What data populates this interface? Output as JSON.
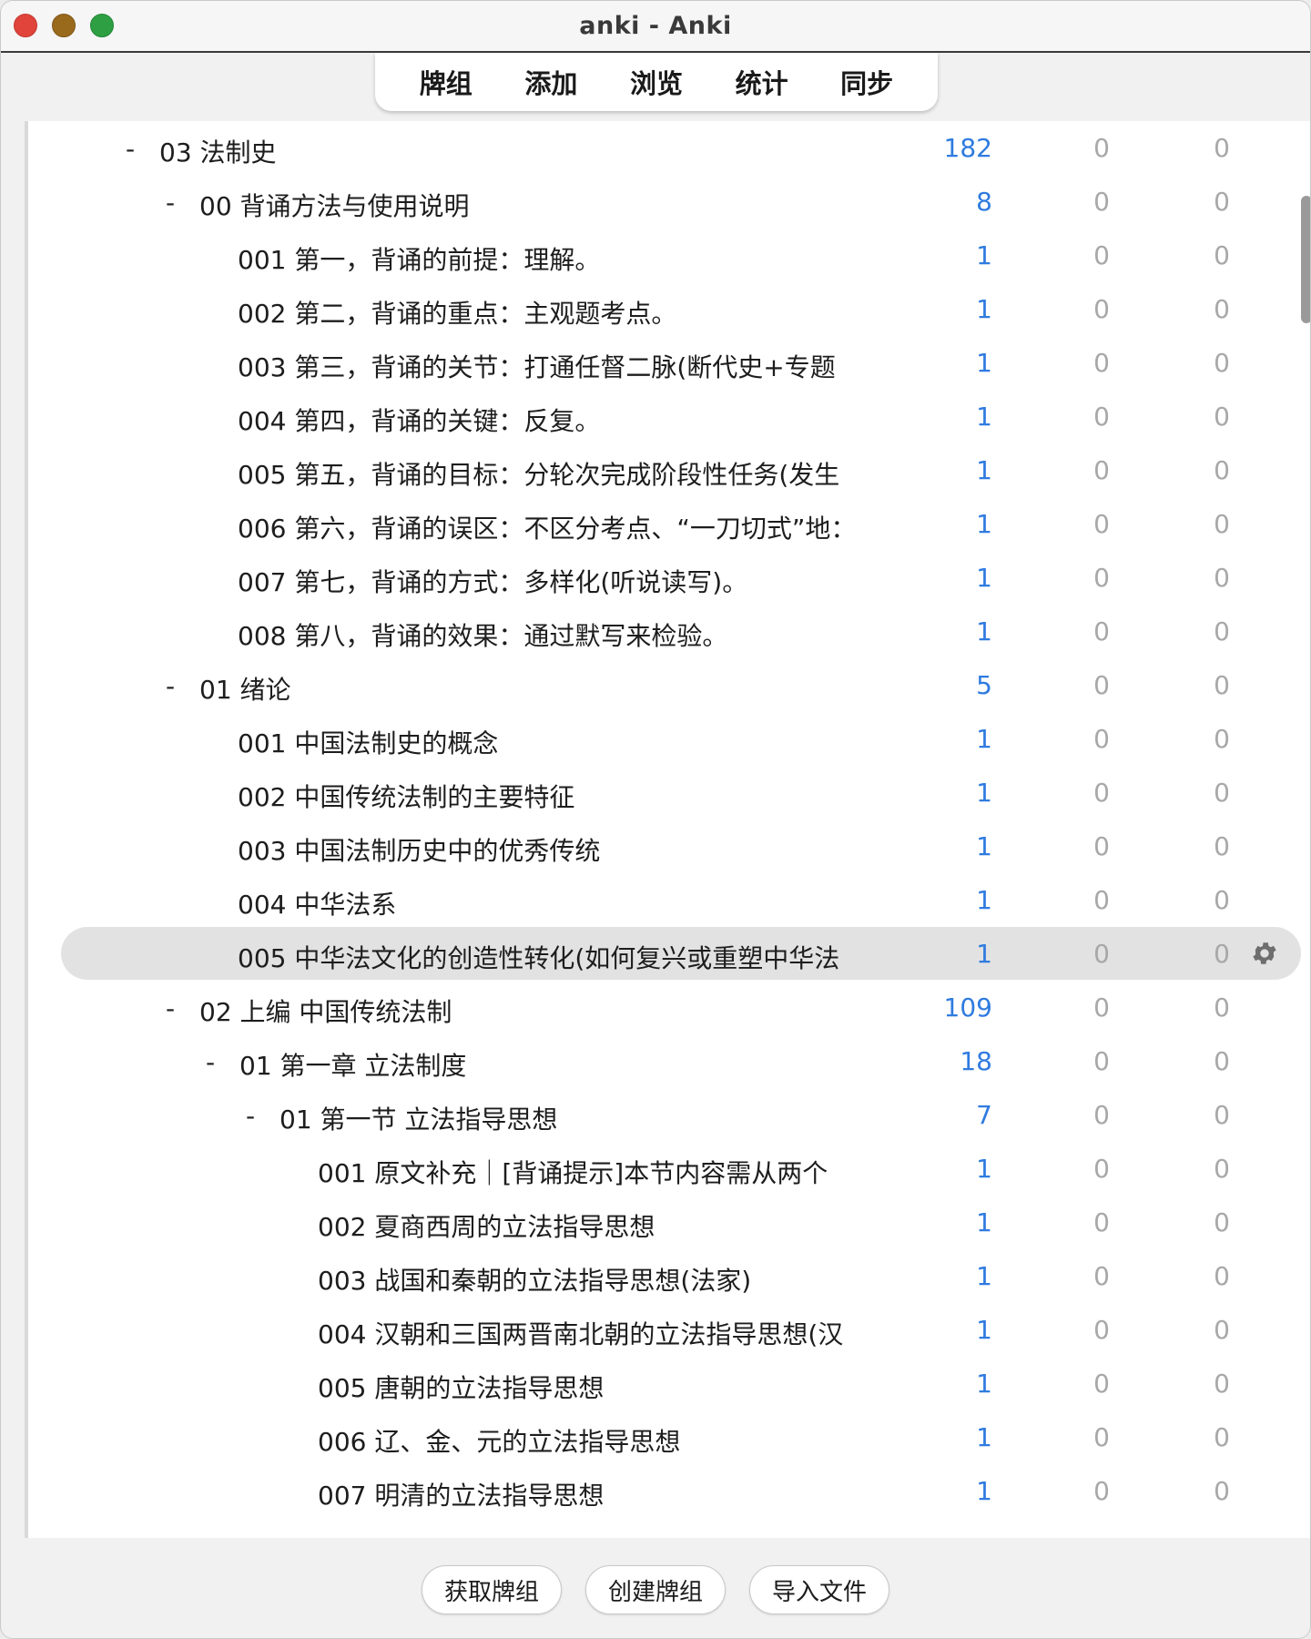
{
  "window": {
    "title": "anki - Anki"
  },
  "toolbar": {
    "items": [
      "牌组",
      "添加",
      "浏览",
      "统计",
      "同步"
    ]
  },
  "decks": [
    {
      "name": "03 法制史",
      "new": "182",
      "learn": "0",
      "due": "0",
      "level": 0,
      "collapse": "-"
    },
    {
      "name": "00 背诵方法与使用说明",
      "new": "8",
      "learn": "0",
      "due": "0",
      "level": 1,
      "collapse": "-"
    },
    {
      "name": "001 第一，背诵的前提：理解。",
      "new": "1",
      "learn": "0",
      "due": "0",
      "level": 2,
      "collapse": ""
    },
    {
      "name": "002 第二，背诵的重点：主观题考点。",
      "new": "1",
      "learn": "0",
      "due": "0",
      "level": 2,
      "collapse": ""
    },
    {
      "name": "003 第三，背诵的关节：打通任督二脉(断代史+专题",
      "new": "1",
      "learn": "0",
      "due": "0",
      "level": 2,
      "collapse": ""
    },
    {
      "name": "004 第四，背诵的关键：反复。",
      "new": "1",
      "learn": "0",
      "due": "0",
      "level": 2,
      "collapse": ""
    },
    {
      "name": "005 第五，背诵的目标：分轮次完成阶段性任务(发生",
      "new": "1",
      "learn": "0",
      "due": "0",
      "level": 2,
      "collapse": ""
    },
    {
      "name": "006 第六，背诵的误区：不区分考点、“一刀切式”地：",
      "new": "1",
      "learn": "0",
      "due": "0",
      "level": 2,
      "collapse": ""
    },
    {
      "name": "007 第七，背诵的方式：多样化(听说读写)。",
      "new": "1",
      "learn": "0",
      "due": "0",
      "level": 2,
      "collapse": ""
    },
    {
      "name": "008 第八，背诵的效果：通过默写来检验。",
      "new": "1",
      "learn": "0",
      "due": "0",
      "level": 2,
      "collapse": ""
    },
    {
      "name": "01 绪论",
      "new": "5",
      "learn": "0",
      "due": "0",
      "level": 1,
      "collapse": "-"
    },
    {
      "name": "001 中国法制史的概念",
      "new": "1",
      "learn": "0",
      "due": "0",
      "level": 2,
      "collapse": ""
    },
    {
      "name": "002 中国传统法制的主要特征",
      "new": "1",
      "learn": "0",
      "due": "0",
      "level": 2,
      "collapse": ""
    },
    {
      "name": "003 中国法制历史中的优秀传统",
      "new": "1",
      "learn": "0",
      "due": "0",
      "level": 2,
      "collapse": ""
    },
    {
      "name": "004 中华法系",
      "new": "1",
      "learn": "0",
      "due": "0",
      "level": 2,
      "collapse": ""
    },
    {
      "name": "005 中华法文化的创造性转化(如何复兴或重塑中华法",
      "new": "1",
      "learn": "0",
      "due": "0",
      "level": 2,
      "collapse": "",
      "selected": true
    },
    {
      "name": "02 上编 中国传统法制",
      "new": "109",
      "learn": "0",
      "due": "0",
      "level": 1,
      "collapse": "-"
    },
    {
      "name": "01 第一章 立法制度",
      "new": "18",
      "learn": "0",
      "due": "0",
      "level": 2,
      "collapse": "-"
    },
    {
      "name": "01 第一节 立法指导思想",
      "new": "7",
      "learn": "0",
      "due": "0",
      "level": 3,
      "collapse": "-"
    },
    {
      "name": "001 原文补充｜[背诵提示]本节内容需从两个",
      "new": "1",
      "learn": "0",
      "due": "0",
      "level": 4,
      "collapse": ""
    },
    {
      "name": "002 夏商西周的立法指导思想",
      "new": "1",
      "learn": "0",
      "due": "0",
      "level": 4,
      "collapse": ""
    },
    {
      "name": "003 战国和秦朝的立法指导思想(法家)",
      "new": "1",
      "learn": "0",
      "due": "0",
      "level": 4,
      "collapse": ""
    },
    {
      "name": "004 汉朝和三国两晋南北朝的立法指导思想(汉",
      "new": "1",
      "learn": "0",
      "due": "0",
      "level": 4,
      "collapse": ""
    },
    {
      "name": "005 唐朝的立法指导思想",
      "new": "1",
      "learn": "0",
      "due": "0",
      "level": 4,
      "collapse": ""
    },
    {
      "name": "006 辽、金、元的立法指导思想",
      "new": "1",
      "learn": "0",
      "due": "0",
      "level": 4,
      "collapse": ""
    },
    {
      "name": "007 明清的立法指导思想",
      "new": "1",
      "learn": "0",
      "due": "0",
      "level": 4,
      "collapse": ""
    }
  ],
  "icons": {
    "gear": "gear-icon"
  },
  "colors": {
    "new_count": "#2f7be0",
    "zero_count": "#a8a8a8",
    "selected_row": "#e2e2e2"
  },
  "bottom": {
    "get_shared": "获取牌组",
    "create_deck": "创建牌组",
    "import_file": "导入文件"
  }
}
